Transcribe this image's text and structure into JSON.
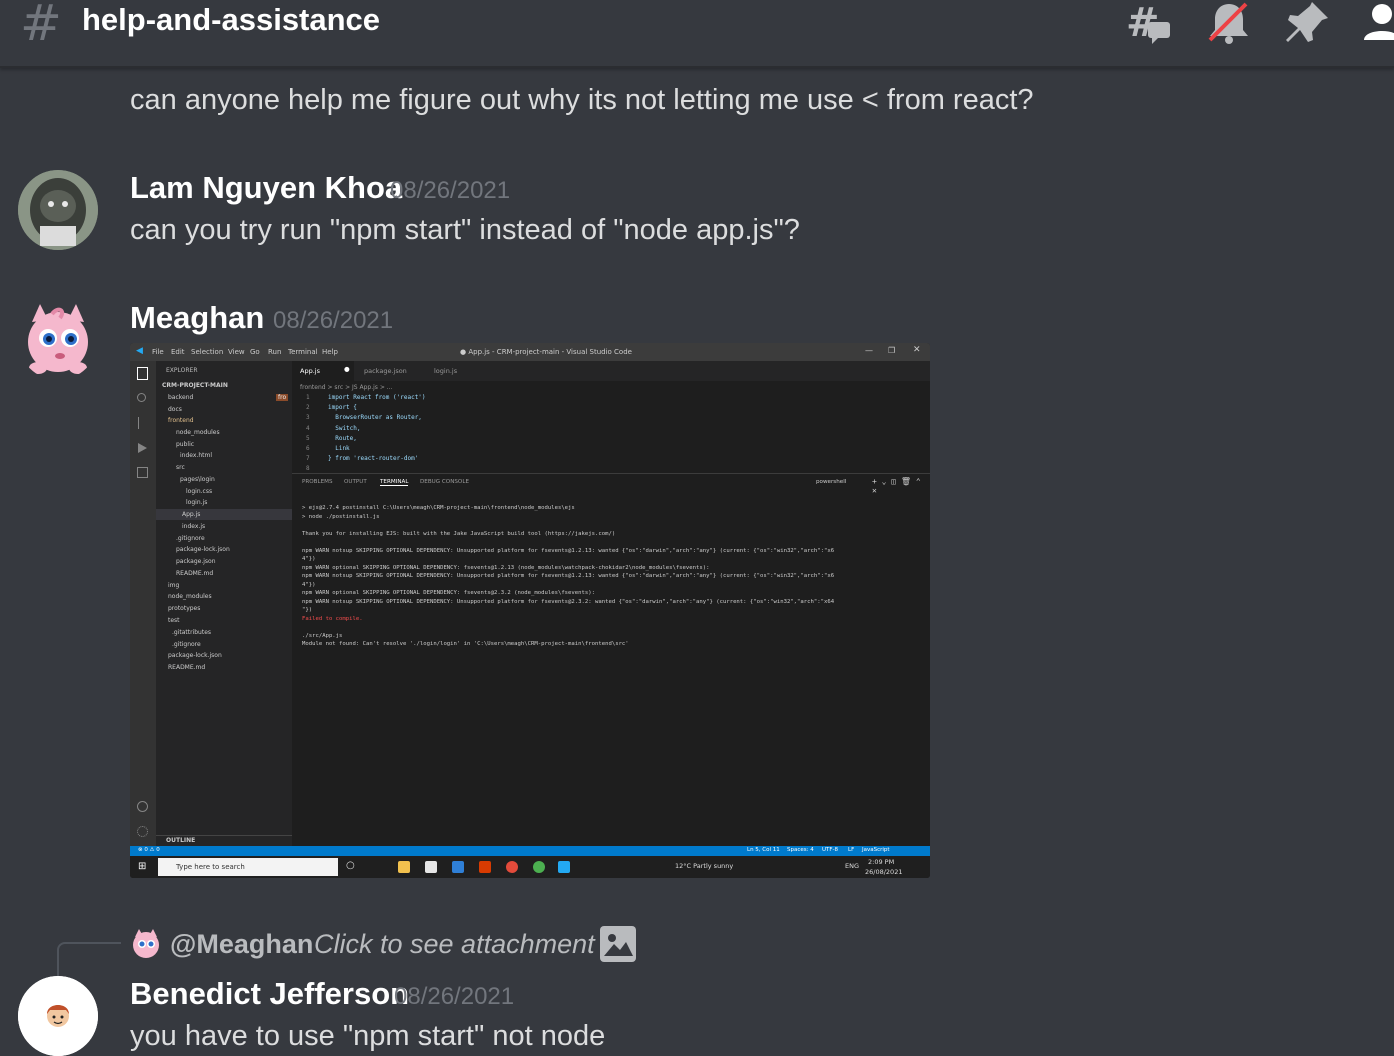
{
  "header": {
    "hash_symbol": "#",
    "channel_name": "help-and-assistance",
    "icons": [
      "threads-icon",
      "notification-muted-icon",
      "pin-icon",
      "member-list-icon"
    ]
  },
  "messages": [
    {
      "text": "can anyone help me figure out why its not letting me use < from react?"
    },
    {
      "author": "Lam Nguyen Khoa",
      "timestamp": "08/26/2021",
      "text": "can you try run \"npm start\" instead of \"node app.js\"?"
    },
    {
      "author": "Meaghan",
      "timestamp": "08/26/2021",
      "attachment": "screenshot"
    },
    {
      "reply_to": {
        "mention": "@Meaghan",
        "text": "Click to see attachment"
      },
      "author": "Benedict Jefferson",
      "timestamp": "08/26/2021",
      "text": "you have to use \"npm start\" not node"
    }
  ],
  "screenshot": {
    "menu": [
      "File",
      "Edit",
      "Selection",
      "View",
      "Go",
      "Run",
      "Terminal",
      "Help"
    ],
    "window_title": "● App.js - CRM-project-main - Visual Studio Code",
    "explorer_title": "EXPLORER",
    "project": "CRM-PROJECT-MAIN",
    "tree": [
      "backend",
      "docs",
      "frontend",
      "node_modules",
      "public",
      "index.html",
      "src",
      "pages\\login",
      "login.css",
      "login.js",
      "App.js",
      "index.js",
      ".gitignore",
      "package-lock.json",
      "package.json",
      "README.md",
      "img",
      "node_modules",
      "prototypes",
      "test",
      ".gitattributes",
      ".gitignore",
      "package-lock.json",
      "README.md"
    ],
    "outline": "OUTLINE",
    "tabs": [
      "App.js",
      "package.json",
      "login.js"
    ],
    "breadcrumb": "frontend > src > JS App.js > ...",
    "code": [
      "import React from ('react')",
      "import {",
      "  BrowserRouter as Router,",
      "  Switch,",
      "  Route,",
      "  Link",
      "} from 'react-router-dom'",
      ""
    ],
    "panel_tabs": [
      "PROBLEMS",
      "OUTPUT",
      "TERMINAL",
      "DEBUG CONSOLE"
    ],
    "terminal_shell": "powershell",
    "terminal": [
      "> ejs@2.7.4 postinstall C:\\Users\\meagh\\CRM-project-main\\frontend\\node_modules\\ejs",
      "> node ./postinstall.js",
      "",
      "Thank you for installing EJS: built with the Jake JavaScript build tool (https://jakejs.com/)",
      "",
      "npm WARN notsup SKIPPING OPTIONAL DEPENDENCY: Unsupported platform for fsevents@1.2.13: wanted {\"os\":\"darwin\",\"arch\":\"any\"} (current: {\"os\":\"win32\",\"arch\":\"x6",
      "4\"})",
      "npm WARN optional SKIPPING OPTIONAL DEPENDENCY: fsevents@1.2.13 (node_modules\\watchpack-chokidar2\\node_modules\\fsevents):",
      "npm WARN notsup SKIPPING OPTIONAL DEPENDENCY: Unsupported platform for fsevents@1.2.13: wanted {\"os\":\"darwin\",\"arch\":\"any\"} (current: {\"os\":\"win32\",\"arch\":\"x6",
      "4\"})",
      "npm WARN optional SKIPPING OPTIONAL DEPENDENCY: fsevents@2.3.2 (node_modules\\fsevents):",
      "npm WARN notsup SKIPPING OPTIONAL DEPENDENCY: Unsupported platform for fsevents@2.3.2: wanted {\"os\":\"darwin\",\"arch\":\"any\"} (current: {\"os\":\"win32\",\"arch\":\"x64",
      "\"})",
      "Failed to compile.",
      "",
      "./src/App.js",
      "Module not found: Can't resolve './login/login' in 'C:\\Users\\meagh\\CRM-project-main\\frontend\\src'"
    ],
    "status_right": [
      "Ln 5, Col 11",
      "Spaces: 4",
      "UTF-8",
      "LF",
      "JavaScript"
    ],
    "status_left": "⊗ 0 ⚠ 0",
    "taskbar_search": "Type here to search",
    "weather": "12°C  Partly sunny",
    "lang": "ENG",
    "time": "2:09 PM",
    "date": "26/08/2021"
  },
  "colors": {
    "background": "#36393f",
    "author": "#ffffff",
    "text": "#dcddde",
    "muted": "#72767d",
    "vscode_blue": "#007acc"
  }
}
